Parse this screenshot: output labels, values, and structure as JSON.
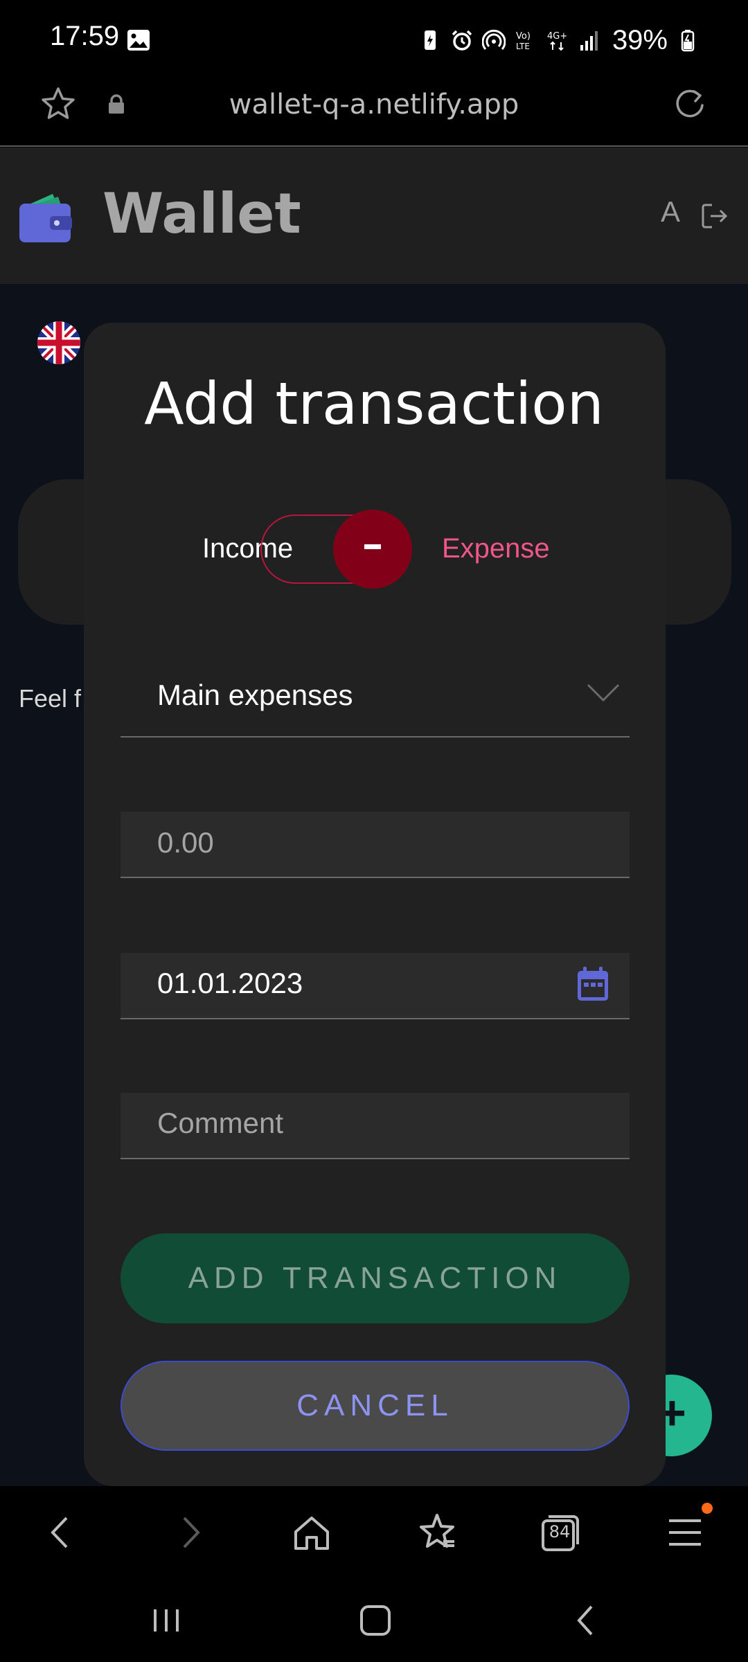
{
  "status_bar": {
    "time": "17:59",
    "battery": "39%",
    "icons": [
      "image-icon",
      "battery-saver-icon",
      "alarm-icon",
      "hotspot-icon",
      "volte-icon",
      "4g-icon",
      "signal-icon",
      "battery-icon"
    ]
  },
  "browser": {
    "url": "wallet-q-a.netlify.app",
    "tabs_count": "84"
  },
  "app": {
    "title": "Wallet",
    "user_initial": "A",
    "background_text": "Feel f"
  },
  "modal": {
    "title": "Add transaction",
    "toggle": {
      "income_label": "Income",
      "expense_label": "Expense",
      "selected": "Expense",
      "knob_symbol": "-"
    },
    "category": {
      "value": "Main expenses"
    },
    "amount": {
      "placeholder": "0.00"
    },
    "date": {
      "value": "01.01.2023"
    },
    "comment": {
      "placeholder": "Comment"
    },
    "add_button_label": "ADD TRANSACTION",
    "cancel_button_label": "CANCEL"
  },
  "colors": {
    "modal_bg": "#212121",
    "page_bg": "#0d111a",
    "expense_accent": "#f0568a",
    "toggle_knob": "#820018",
    "add_button": "#114c36",
    "cancel_border": "#3e4bd1",
    "cancel_text": "#8d93f0",
    "fab": "#24b78f"
  }
}
